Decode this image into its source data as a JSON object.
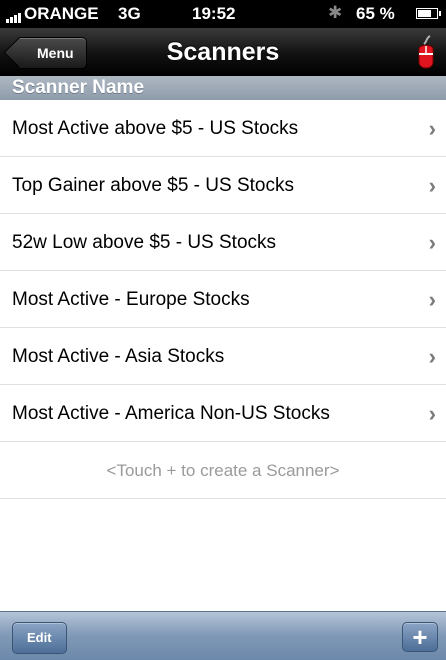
{
  "status_bar": {
    "carrier": "ORANGE",
    "network": "3G",
    "time": "19:52",
    "battery": "65 %",
    "icons": [
      "signal-icon",
      "bluetooth-icon",
      "battery-icon"
    ]
  },
  "nav": {
    "back_label": "Menu",
    "title": "Scanners",
    "right_icon": "mouse-icon"
  },
  "section_header": "Scanner Name",
  "scanners": [
    "Most Active above $5 - US Stocks",
    "Top Gainer above $5 - US Stocks",
    "52w Low above $5 - US Stocks",
    "Most Active - Europe Stocks",
    "Most Active - Asia Stocks",
    "Most Active - America Non-US Stocks"
  ],
  "hint": "<Touch + to create a Scanner>",
  "toolbar": {
    "edit_label": "Edit",
    "add_label": "+"
  },
  "colors": {
    "nav_bar": "#000000",
    "section_header": "#9aa6b4",
    "toolbar": "#7f98b5",
    "hint_text": "#9a9a9a"
  }
}
